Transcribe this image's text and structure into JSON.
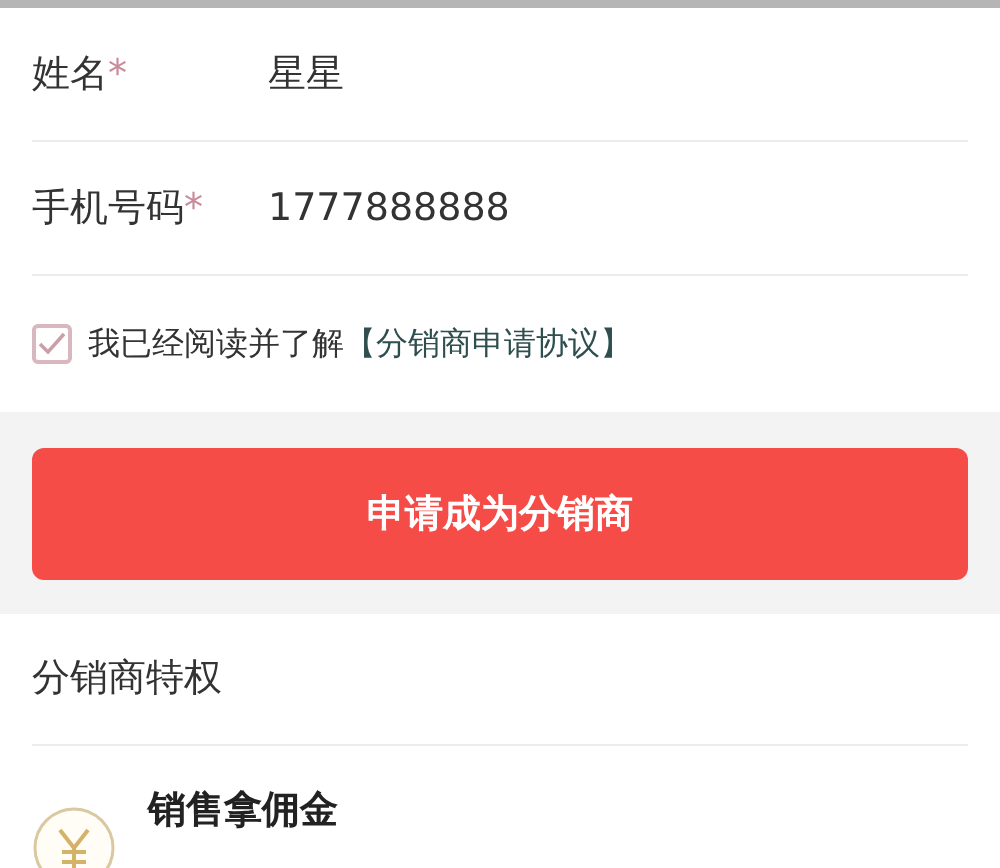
{
  "form": {
    "fields": [
      {
        "label": "姓名",
        "required_mark": "*",
        "value": "星星"
      },
      {
        "label": "手机号码",
        "required_mark": "*",
        "value": "1777888888"
      }
    ]
  },
  "agreement": {
    "checked": true,
    "text": "我已经阅读并了解",
    "link": "【分销商申请协议】"
  },
  "submit_button": "申请成为分销商",
  "privileges": {
    "title": "分销商特权",
    "items": [
      {
        "title": "销售拿佣金"
      }
    ]
  }
}
